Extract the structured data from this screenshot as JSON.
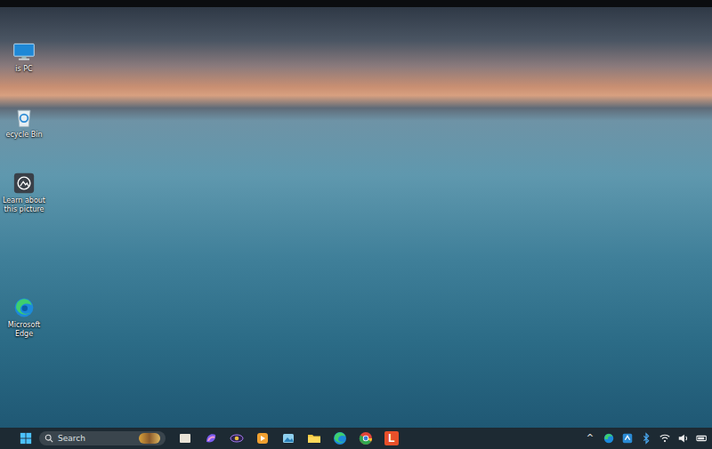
{
  "desktop_icons": [
    {
      "label": "is PC",
      "kind": "pc"
    },
    {
      "label": "ecycle Bin",
      "kind": "bin"
    },
    {
      "label": "Learn about this picture",
      "kind": "learn"
    },
    {
      "label": "Microsoft Edge",
      "kind": "edge"
    }
  ],
  "taskbar": {
    "search": {
      "placeholder": "Search"
    },
    "apps": [
      {
        "kind": "files"
      },
      {
        "kind": "copilot"
      },
      {
        "kind": "eye"
      },
      {
        "kind": "media"
      },
      {
        "kind": "photos"
      },
      {
        "kind": "folder"
      },
      {
        "kind": "edge"
      },
      {
        "kind": "chrome"
      },
      {
        "kind": "letter",
        "text": "L"
      }
    ],
    "tray": [
      {
        "kind": "chevron",
        "text": "^"
      },
      {
        "kind": "edge"
      },
      {
        "kind": "sync"
      },
      {
        "kind": "bluetooth"
      },
      {
        "kind": "wifi"
      },
      {
        "kind": "speaker"
      },
      {
        "kind": "battery"
      }
    ]
  }
}
